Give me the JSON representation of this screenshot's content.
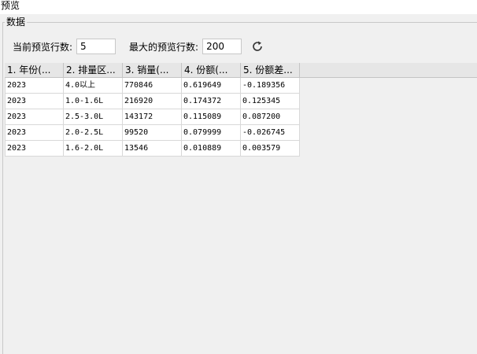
{
  "window": {
    "title": "预览"
  },
  "group": {
    "legend": "数据"
  },
  "controls": {
    "current_rows_label": "当前预览行数:",
    "current_rows_value": "5",
    "max_rows_label": "最大的预览行数:",
    "max_rows_value": "200",
    "refresh_icon": "refresh-icon"
  },
  "table": {
    "columns": [
      "1. 年份(...",
      "2. 排量区...",
      "3. 销量(...",
      "4. 份额(...",
      "5. 份额差..."
    ],
    "rows": [
      [
        "2023",
        "4.0以上",
        "770846",
        "0.619649",
        "-0.189356"
      ],
      [
        "2023",
        "1.0-1.6L",
        "216920",
        "0.174372",
        "0.125345"
      ],
      [
        "2023",
        "2.5-3.0L",
        "143172",
        "0.115089",
        "0.087200"
      ],
      [
        "2023",
        "2.0-2.5L",
        "99520",
        "0.079999",
        "-0.026745"
      ],
      [
        "2023",
        "1.6-2.0L",
        "13546",
        "0.010889",
        "0.003579"
      ]
    ]
  }
}
